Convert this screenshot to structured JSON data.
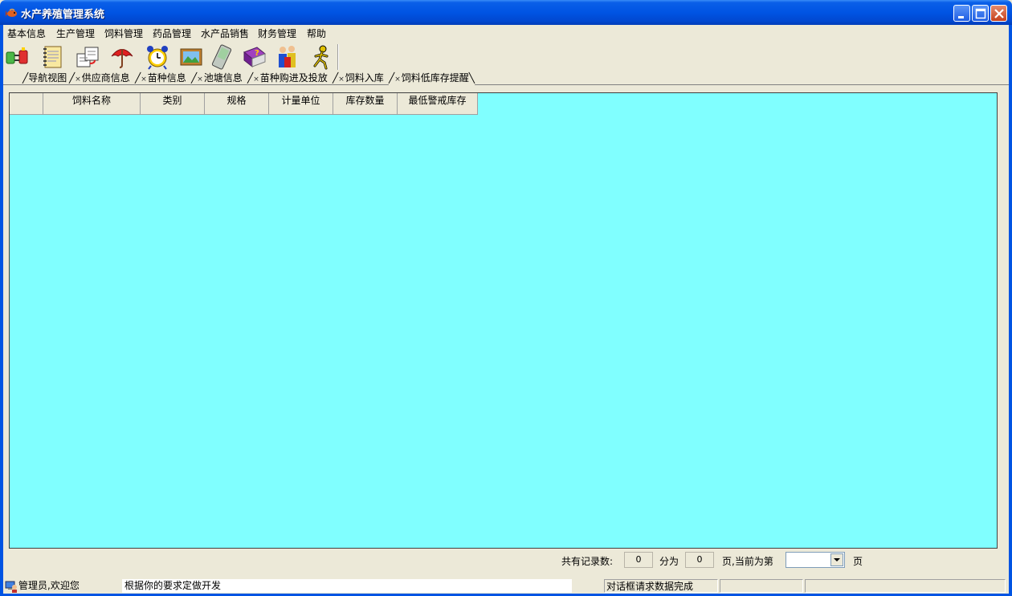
{
  "window": {
    "title": "水产养殖管理系统"
  },
  "menu": {
    "items": [
      "基本信息",
      "生产管理",
      "饲料管理",
      "药品管理",
      "水产品销售",
      "财务管理",
      "帮助"
    ]
  },
  "toolbar": {
    "icons": [
      "connect-plug-icon",
      "notebook-icon",
      "documents-transfer-icon",
      "umbrella-icon",
      "alarm-clock-icon",
      "picture-frame-icon",
      "pda-icon",
      "help-book-icon",
      "users-icon",
      "running-man-icon"
    ]
  },
  "tabs": {
    "items": [
      "导航视图",
      "供应商信息",
      "苗种信息",
      "池塘信息",
      "苗种购进及投放",
      "饲料入库",
      "饲料低库存提醒"
    ],
    "close_glyph": "×",
    "active_index": 6
  },
  "grid": {
    "columns": [
      "",
      "饲料名称",
      "类别",
      "规格",
      "计量单位",
      "库存数量",
      "最低警戒库存"
    ],
    "rows": [],
    "background": "#80FFFF"
  },
  "pager": {
    "total_label": "共有记录数:",
    "total_value": "0",
    "pages_label": "分为",
    "pages_value": "0",
    "current_label": "页,当前为第",
    "current_value": "",
    "page_suffix": "页"
  },
  "status": {
    "user_text": "管理员,欢迎您",
    "message": "根据你的要求定做开发",
    "dialog_status": "对话框请求数据完成"
  }
}
